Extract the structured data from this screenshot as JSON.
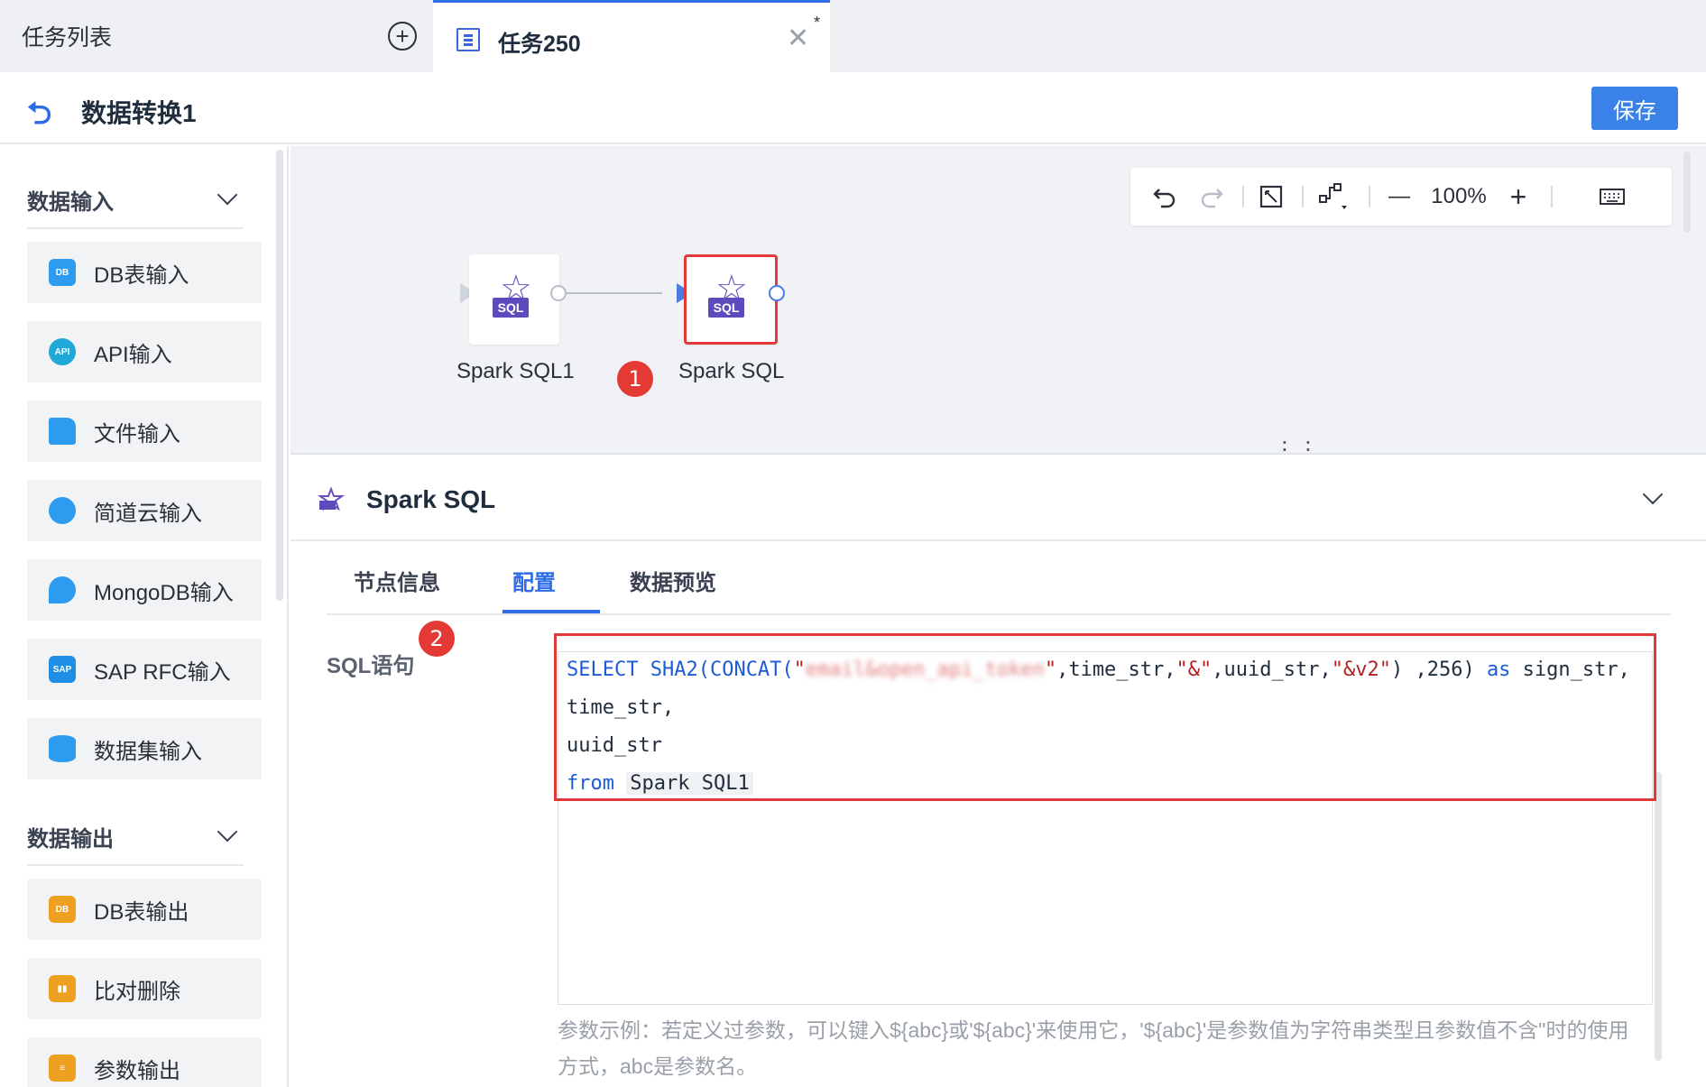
{
  "tabbar": {
    "task_list_label": "任务列表",
    "add_icon": "plus-circle-icon",
    "active_tab_label": "任务250",
    "close_glyph": "✕",
    "modified_marker": "*"
  },
  "header": {
    "title": "数据转换1",
    "save_label": "保存"
  },
  "sidebar": {
    "input_section": "数据输入",
    "inputs": [
      {
        "label": "DB表输入",
        "icon": "db-table-icon",
        "color": "#2d9cf0"
      },
      {
        "label": "API输入",
        "icon": "api-icon",
        "color": "#1fa8d8"
      },
      {
        "label": "文件输入",
        "icon": "folder-icon",
        "color": "#2d9cf0"
      },
      {
        "label": "简道云输入",
        "icon": "cloud-icon",
        "color": "#2d9cf0"
      },
      {
        "label": "MongoDB输入",
        "icon": "leaf-icon",
        "color": "#2d9cf0"
      },
      {
        "label": "SAP RFC输入",
        "icon": "sap-icon",
        "color": "#1f8fe6"
      },
      {
        "label": "数据集输入",
        "icon": "database-icon",
        "color": "#2d9cf0"
      }
    ],
    "output_section": "数据输出",
    "outputs": [
      {
        "label": "DB表输出",
        "icon": "db-export-icon",
        "color": "#f0a020"
      },
      {
        "label": "比对删除",
        "icon": "compare-icon",
        "color": "#f0a020"
      },
      {
        "label": "参数输出",
        "icon": "param-output-icon",
        "color": "#f0a020"
      }
    ]
  },
  "toolbar": {
    "zoom": "100%",
    "minus": "—",
    "plus": "+"
  },
  "canvas": {
    "nodes": [
      {
        "label": "Spark SQL1",
        "badge": "SQL"
      },
      {
        "label": "Spark SQL",
        "badge": "SQL"
      }
    ],
    "annotation_1": "1",
    "splitter": "⋮⋮"
  },
  "panel": {
    "title": "Spark SQL",
    "tabs": [
      "节点信息",
      "配置",
      "数据预览"
    ],
    "active_tab": "配置",
    "sql_label": "SQL语句",
    "annotation_2": "2",
    "code": {
      "l1_select": "SELECT",
      "l1_fn": " SHA2(CONCAT(",
      "l1_q1": "\"",
      "l1_blurred": "email&open_api_token",
      "l1_q2": "\"",
      "l1_mid": ",time_str,",
      "l1_amp": "\"&\"",
      "l1_mid2": ",uuid_str,",
      "l1_v2": "\"&v2\"",
      "l1_end": ") ,256) ",
      "l1_as": "as",
      "l1_alias": " sign_str,",
      "l2": "time_str,",
      "l3": "uuid_str",
      "l4_from": "from",
      "l4_table": "Spark SQL1"
    },
    "hint": "参数示例：若定义过参数，可以键入${abc}或'${abc}'来使用它，'${abc}'是参数值为字符串类型且参数值不含\"时的使用方式，abc是参数名。"
  }
}
